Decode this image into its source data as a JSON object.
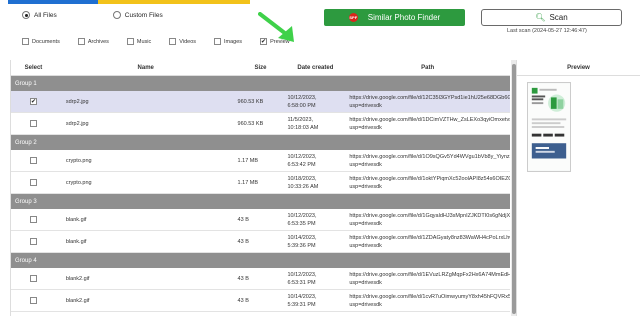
{
  "scope": {
    "all_files": "All Files",
    "custom_files": "Custom Files",
    "selected": "all_files"
  },
  "file_types": [
    {
      "label": "Documents",
      "checked": false
    },
    {
      "label": "Archives",
      "checked": false
    },
    {
      "label": "Music",
      "checked": false
    },
    {
      "label": "Videos",
      "checked": false
    },
    {
      "label": "Images",
      "checked": false
    },
    {
      "label": "Preview",
      "checked": true
    }
  ],
  "toolbar": {
    "finder_label": "Similar Photo Finder",
    "scan_label": "Scan",
    "last_scan": "Last scan (2024-05-27 12:46:47)"
  },
  "table": {
    "headers": {
      "select": "Select",
      "name": "Name",
      "size": "Size",
      "date": "Date created",
      "path": "Path"
    },
    "groups": [
      {
        "label": "Group 1",
        "rows": [
          {
            "checked": true,
            "selected": true,
            "name": "sdrp2.jpg",
            "size": "960.53 KB",
            "date1": "10/12/2023,",
            "date2": "6:58:00 PM",
            "path1": "https://drive.google.com/file/d/12C35l3GYPsd1ie1hU25e68DGb6GGlNc/view?",
            "path2": "usp=drivesdk"
          },
          {
            "checked": false,
            "selected": false,
            "name": "sdrp2.jpg",
            "size": "960.53 KB",
            "date1": "11/5/2023,",
            "date2": "10:18:03 AM",
            "path1": "https://drive.google.com/file/d/1DCimVZTHw_ZsLEXo3qyiOmxetvsA1/view?",
            "path2": "usp=drivesdk"
          }
        ]
      },
      {
        "label": "Group 2",
        "rows": [
          {
            "checked": false,
            "selected": false,
            "name": "crypto.png",
            "size": "1.17 MB",
            "date1": "10/12/2023,",
            "date2": "6:53:42 PM",
            "path1": "https://drive.google.com/file/d/1O9sQGv5Yd4WVgu1bVb8y_Yiynz2XPk/view?",
            "path2": "usp=drivesdk"
          },
          {
            "checked": false,
            "selected": false,
            "name": "crypto.png",
            "size": "1.17 MB",
            "date1": "10/18/2023,",
            "date2": "10:33:26 AM",
            "path1": "https://drive.google.com/file/d/1oktYPiqmXc52oolAPI8z54s6OIEZO9ad/view?",
            "path2": "usp=drivesdk"
          }
        ]
      },
      {
        "label": "Group 3",
        "rows": [
          {
            "checked": false,
            "selected": false,
            "name": "blank.gif",
            "size": "43 B",
            "date1": "10/12/2023,",
            "date2": "6:53:35 PM",
            "path1": "https://drive.google.com/file/d/1GqyaldHJ3sMpnIZJKDTI0s6gNdjXxE6Tb/view?",
            "path2": "usp=drivesdk"
          },
          {
            "checked": false,
            "selected": false,
            "name": "blank.gif",
            "size": "43 B",
            "date1": "10/14/2023,",
            "date2": "5:39:36 PM",
            "path1": "https://drive.google.com/file/d/1ZDAGyaty8nz83WaWH4cPoLrxLhwUMp0/view?",
            "path2": "usp=drivesdk"
          }
        ]
      },
      {
        "label": "Group 4",
        "rows": [
          {
            "checked": false,
            "selected": false,
            "name": "blank2.gif",
            "size": "43 B",
            "date1": "10/12/2023,",
            "date2": "6:53:31 PM",
            "path1": "https://drive.google.com/file/d/1EVuzLRZgMqpFx2Hx6A74MmEdHY-I7N1/view?",
            "path2": "usp=drivesdk"
          },
          {
            "checked": false,
            "selected": false,
            "name": "blank2.gif",
            "size": "43 B",
            "date1": "10/14/2023,",
            "date2": "5:39:31 PM",
            "path1": "https://drive.google.com/file/d/1cvR7uOimwyumyY8xh45hFQVRx5HMtDP4F/view?",
            "path2": "usp=drivesdk"
          }
        ]
      }
    ]
  },
  "preview": {
    "title": "Preview"
  },
  "colors": {
    "accent_green": "#2d9a3f",
    "group_header": "#8f8f8f",
    "selected_row": "#dedff1",
    "arrow_green": "#3fd14a"
  }
}
